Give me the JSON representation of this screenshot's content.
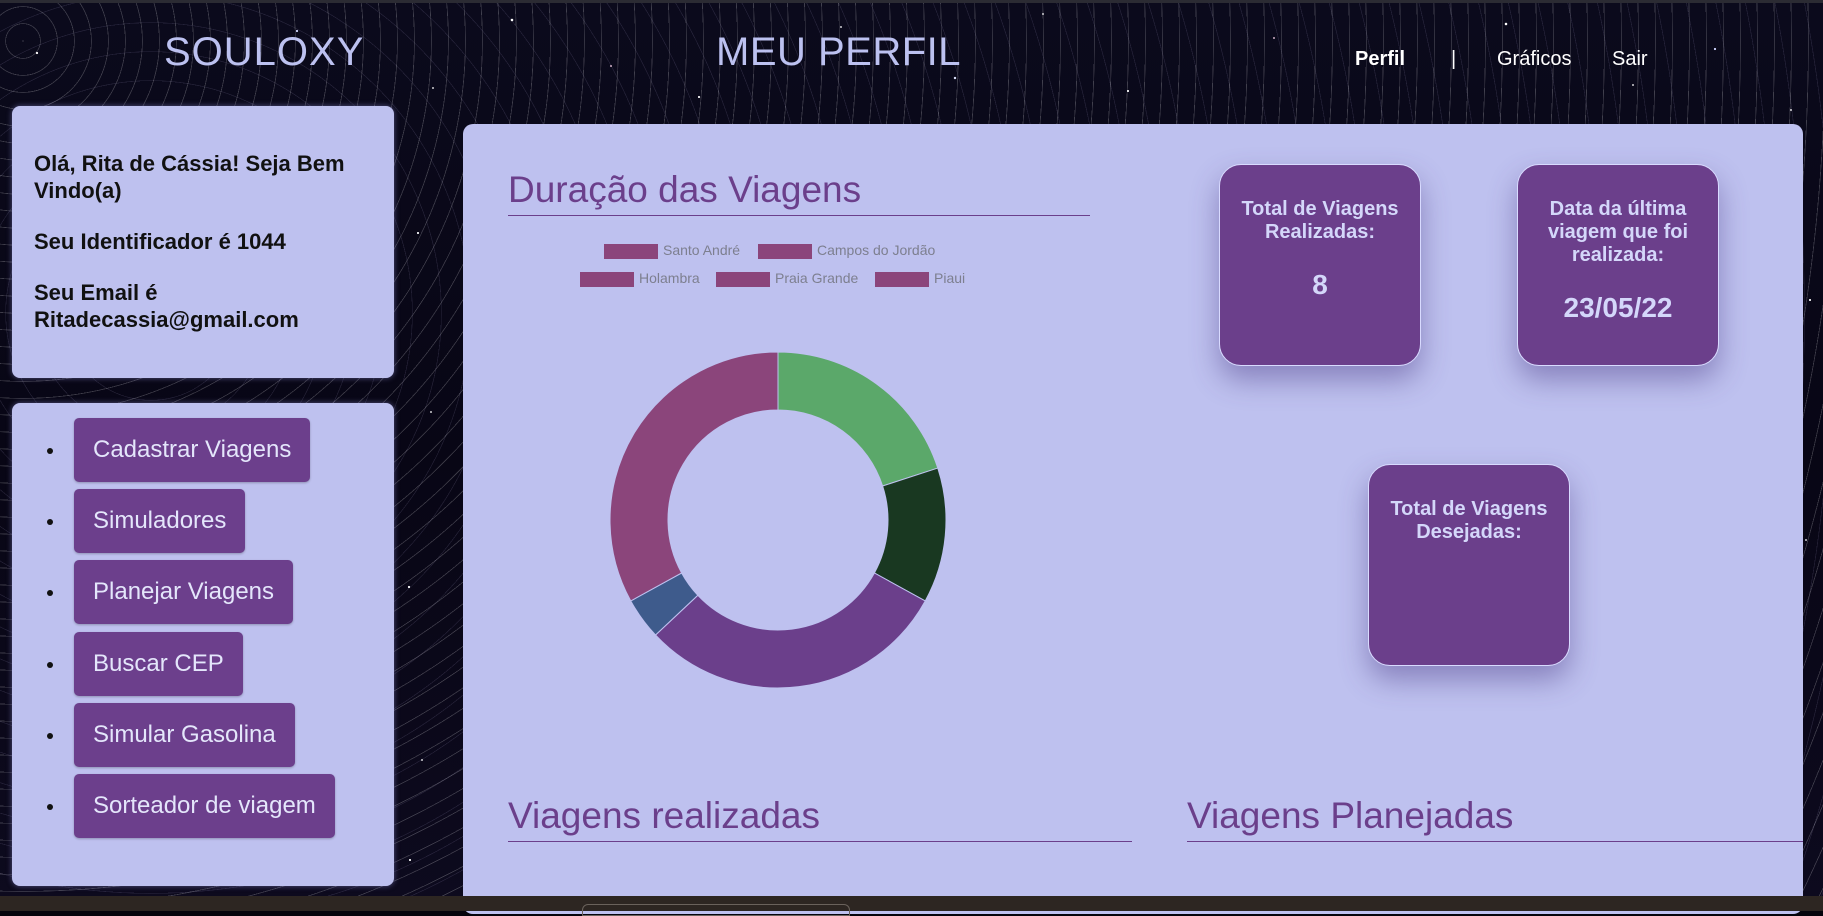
{
  "header": {
    "brand": "SOULOXY",
    "title": "MEU PERFIL",
    "nav": {
      "active": "Perfil",
      "separator": "|",
      "graficos": "Gráficos",
      "sair": "Sair"
    }
  },
  "profile": {
    "greeting_line1": "Olá, Rita de Cássia! Seja Bem",
    "greeting_line2": "Vindo(a)",
    "identifier": "Seu Identificador é 1044",
    "email_line1": "Seu Email é",
    "email_line2": "Ritadecassia@gmail.com"
  },
  "menu": {
    "items": [
      {
        "label": "Cadastrar Viagens"
      },
      {
        "label": "Simuladores"
      },
      {
        "label": "Planejar Viagens"
      },
      {
        "label": "Buscar CEP"
      },
      {
        "label": "Simular Gasolina"
      },
      {
        "label": "Sorteador de viagem"
      }
    ]
  },
  "main": {
    "chart_title": "Duração das Viagens",
    "section_realizadas": "Viagens realizadas",
    "section_planejadas": "Viagens Planejadas"
  },
  "stats": {
    "total_label": "Total de Viagens Realizadas:",
    "total_value": "8",
    "data_label": "Data da última viagem que foi realizada:",
    "data_value": "23/05/22",
    "desejadas_label": "Total de Viagens Desejadas:",
    "desejadas_value": ""
  },
  "chart_data": {
    "type": "pie",
    "variant": "doughnut",
    "title": "Duração das Viagens",
    "legend": [
      "Santo André",
      "Campos do Jordão",
      "Holambra",
      "Praia Grande",
      "Piaui"
    ],
    "legend_color": "#8b457b",
    "slices": [
      {
        "value": 20,
        "color": "#5ba86a"
      },
      {
        "value": 13,
        "color": "#193821"
      },
      {
        "value": 30,
        "color": "#6b3f8b"
      },
      {
        "value": 4,
        "color": "#3e5b8c"
      },
      {
        "value": 33,
        "color": "#8b457b"
      }
    ]
  },
  "colors": {
    "accent": "#6b3f8b",
    "panel": "#bec1ef",
    "text_light": "#bcc1f0"
  }
}
